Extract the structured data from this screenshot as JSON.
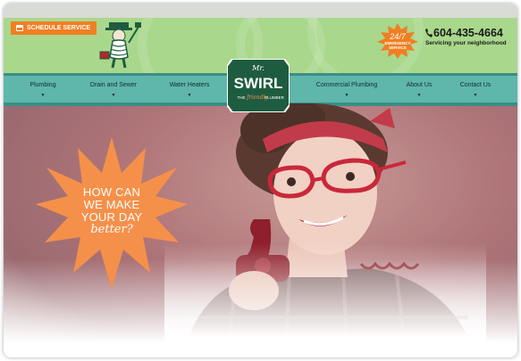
{
  "header": {
    "schedule_label": "SCHEDULE SERVICE",
    "badge_line1": "24/7",
    "badge_line2": "EMERGENCY",
    "badge_line3": "SERVICE",
    "phone": "604-435-4664",
    "phone_sub": "Servicing your neighborhood"
  },
  "logo": {
    "prefix": "Mr.",
    "name": "SWIRL",
    "tagline_the": "THE",
    "tagline_friendly": "friendly",
    "tagline_plumber": "PLUMBER"
  },
  "nav": {
    "items": [
      {
        "label": "Plumbing"
      },
      {
        "label": "Drain and Sewer"
      },
      {
        "label": "Water Heaters"
      },
      {
        "label": "Commercial Plumbing"
      },
      {
        "label": "About Us"
      },
      {
        "label": "Contact Us"
      }
    ],
    "arrow": "▼"
  },
  "hero": {
    "line1": "HOW CAN",
    "line2": "WE MAKE",
    "line3": "YOUR DAY",
    "line4": "better?"
  },
  "colors": {
    "header_green": "#a9d88c",
    "nav_teal": "#5fb6ab",
    "accent_orange": "#f07f23",
    "logo_green": "#1e5c3f"
  },
  "icons": [
    "calendar-icon",
    "phone-icon",
    "starburst-badge",
    "mascot-plumber",
    "down-arrow-icon"
  ]
}
